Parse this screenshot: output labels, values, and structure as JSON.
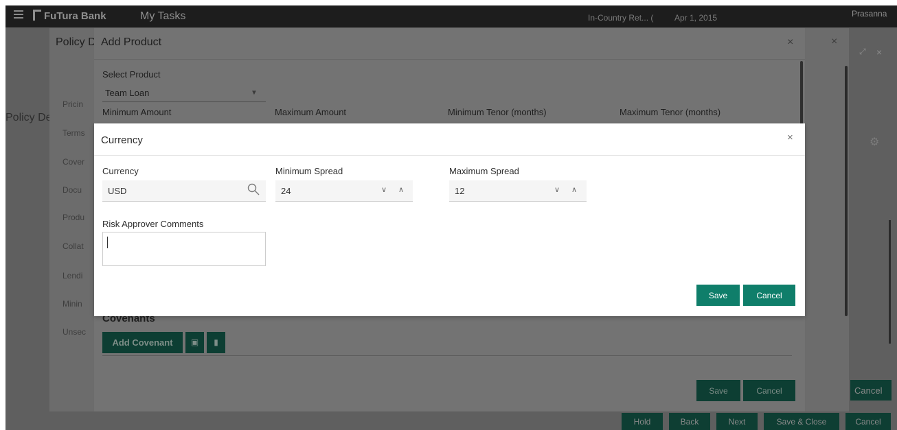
{
  "topbar": {
    "brand": "FuTura Bank",
    "page": "My Tasks",
    "branch": "In-Country Ret... (",
    "date": "Apr 1, 2015",
    "user": "Prasanna"
  },
  "base": {
    "side_label": "Policy De",
    "bottom_buttons": [
      "Hold",
      "Back",
      "Next",
      "Save & Close",
      "Cancel"
    ]
  },
  "policy_modal": {
    "title": "Policy D",
    "nav": [
      "Pricin",
      "Terms",
      "Cover",
      "Docu",
      "Produ",
      "Collat",
      "Lendi",
      "Minin",
      "Unsec"
    ],
    "cancel_label": "Cancel"
  },
  "add_product": {
    "title": "Add Product",
    "select_product_label": "Select Product",
    "select_product_value": "Team Loan",
    "min_amount_label": "Minimum Amount",
    "max_amount_label": "Maximum Amount",
    "min_tenor_label": "Minimum Tenor (months)",
    "max_tenor_label": "Maximum Tenor (months)",
    "covenants_heading": "Covenants",
    "add_covenant_label": "Add Covenant",
    "save_label": "Save",
    "cancel_label": "Cancel"
  },
  "currency_modal": {
    "title": "Currency",
    "currency_label": "Currency",
    "currency_value": "USD",
    "min_spread_label": "Minimum Spread",
    "min_spread_value": "24",
    "max_spread_label": "Maximum Spread",
    "max_spread_value": "12",
    "comments_label": "Risk Approver Comments",
    "comments_value": "",
    "save_label": "Save",
    "cancel_label": "Cancel"
  },
  "colors": {
    "primary_button": "#0f7e6a",
    "header_bar": "#1d1d1d"
  }
}
